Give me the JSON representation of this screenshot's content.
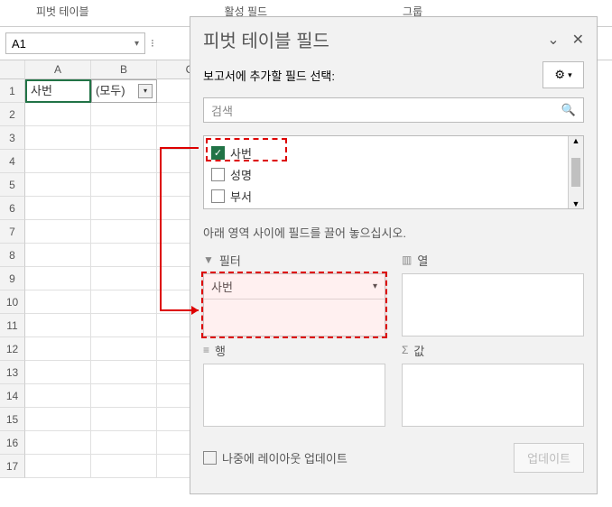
{
  "ribbon": {
    "pivot_table": "피벗 테이블",
    "active_field": "활성 필드",
    "group": "그룹"
  },
  "name_box": {
    "value": "A1"
  },
  "sheet": {
    "cols": [
      "A",
      "B",
      "C"
    ],
    "rows": [
      "1",
      "2",
      "3",
      "4",
      "5",
      "6",
      "7",
      "8",
      "9",
      "10",
      "11",
      "12",
      "13",
      "14",
      "15",
      "16",
      "17"
    ],
    "a1": "사번",
    "b1": "(모두)"
  },
  "pane": {
    "title": "피벗 테이블 필드",
    "choose_label": "보고서에 추가할 필드 선택:",
    "search_placeholder": "검색",
    "fields": [
      {
        "label": "사번",
        "checked": true
      },
      {
        "label": "성명",
        "checked": false
      },
      {
        "label": "부서",
        "checked": false
      }
    ],
    "drag_label": "아래 영역 사이에 필드를 끌어 놓으십시오.",
    "areas": {
      "filter": "필터",
      "columns": "열",
      "rows": "행",
      "values": "값"
    },
    "filter_item": "사번",
    "defer_label": "나중에 레이아웃 업데이트",
    "update_btn": "업데이트"
  }
}
